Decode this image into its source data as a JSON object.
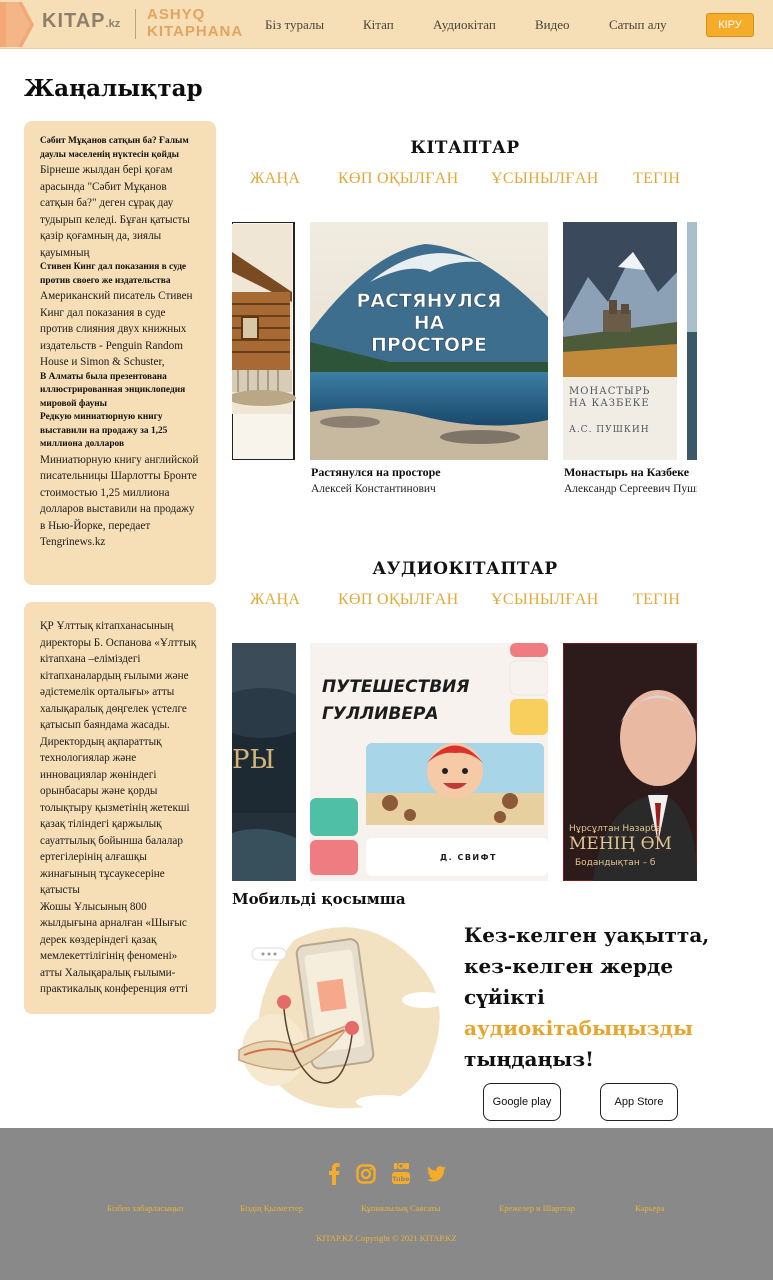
{
  "header": {
    "logo": "KITAP",
    "logo_suffix": ".kz",
    "logo_sub_line1": "ASHYQ",
    "logo_sub_line2": "KITAPHANA",
    "nav": [
      "Біз туралы",
      "Кітап",
      "Аудиокітап",
      "Видео",
      "Сатып алу"
    ],
    "login_label": "КІРУ",
    "brand_color": "#f6dfb6",
    "accent_color": "#f5ac2a"
  },
  "news": {
    "title": "Жаңалықтар",
    "card1": [
      {
        "type": "h",
        "text": "Сәбит Мұқанов сатқын ба? Ғалым даулы мәселенің нүктесін қойды"
      },
      {
        "type": "p",
        "text": "Бірнеше жылдан бері қоғам арасында \"Сәбит Мұқанов сатқын ба?\" деген сұрақ дау тудырып келеді. Бұған қатысты қазір қоғамның да, зиялы қауымның"
      },
      {
        "type": "h",
        "text": "Стивен Кинг дал показания в суде против своего же издательства"
      },
      {
        "type": "p",
        "text": "Американский писатель Стивен Кинг дал показания в суде против слияния двух книжных издательств - Penguin Random House и Simon & Schuster,"
      },
      {
        "type": "h",
        "text": "В Алматы была презентована иллюстрированная энциклопедия мировой фауны"
      },
      {
        "type": "h",
        "text": "Редкую миниатюрную книгу выставили на продажу за 1,25 миллиона долларов"
      },
      {
        "type": "p",
        "text": "Миниатюрную книгу английской писательницы Шарлотты Бронте стоимостью 1,25 миллиона долларов выставили на продажу в Нью-Йорке, передает Tengrinews.kz"
      }
    ],
    "card2": [
      {
        "type": "p",
        "text": "ҚР Ұлттық кітапханасының директоры Б. Оспанова «Ұлттық кітапхана –еліміздегі кітапханалардың ғылыми және әдістемелік орталығы» атты халықаралық дөңгелек үстелге қатысып баяндама жасады."
      },
      {
        "type": "p",
        "text": "Директордың ақпараттық технологиялар және инновациялар жөніндегі орынбасары және қорды толықтыру қызметінің жетекші қазақ тіліндегі қаржылық сауаттылық бойынша балалар ертегілерінің алғашқы жинағының тұсаукесеріне қатысты"
      },
      {
        "type": "p",
        "text": "Жошы Ұлысының 800 жылдығына арналған «Шығыс дерек көздеріндегі қазақ мемлекеттілігінің феномені» атты Халықаралық ғылыми-практикалық конференция өтті"
      }
    ]
  },
  "books": {
    "title": "КІТАПТАР",
    "filters": [
      "ЖАҢА",
      "КӨП ОҚЫЛҒАН",
      "ҰСЫНЫЛҒАН",
      "ТЕГІН"
    ],
    "items": [
      {
        "title": "Растянулся на просторе",
        "author": "Алексей Константинович",
        "cover_text": "РАСТЯНУЛСЯ НА ПРОСТОРЕ"
      },
      {
        "title": "Монастырь на Казбеке",
        "author": "Александр Сергеевич Пушкин",
        "cover_text_1": "МОНАСТЫРЬ НА КАЗБЕКЕ",
        "cover_author": "А.С. ПУШКИН"
      }
    ]
  },
  "audiobooks": {
    "title": "АУДИОКІТАПТАР",
    "filters": [
      "ЖАҢА",
      "КӨП ОҚЫЛҒАН",
      "ҰСЫНЫЛҒАН",
      "ТЕГІН"
    ],
    "covers": [
      {
        "cover_text": "РЫ"
      },
      {
        "cover_text": "ПУТЕШЕСТВИЯ ГУЛЛИВЕРА",
        "cover_author": "Д. СВИФТ"
      },
      {
        "cover_text": "МЕНІҢ ӨМ",
        "cover_top": "Нұрсұлтан Назарба",
        "cover_bottom": "Бодандықтан – б"
      }
    ]
  },
  "mobile": {
    "title": "Мобильді қосымша",
    "promo_line1": "Кез-келген уақытта,",
    "promo_line2": "кез-келген жерде",
    "promo_line3": "сүйікті",
    "promo_highlight": "аудиокітабыңызды",
    "promo_line5": "тыңдаңыз!",
    "google_play": "Google play",
    "app_store": "App Store"
  },
  "footer": {
    "links": [
      "Бізбен хабарласыңыз",
      "Біздің Қызметтер",
      "Құпиялылық Саясаты",
      "Ережелер и Шарттар",
      "Карьера"
    ],
    "copyright": "KITAP.KZ Copyright © 2021 KITAP.KZ",
    "social_icons": [
      "facebook-icon",
      "instagram-icon",
      "youtube-icon",
      "twitter-icon"
    ]
  }
}
